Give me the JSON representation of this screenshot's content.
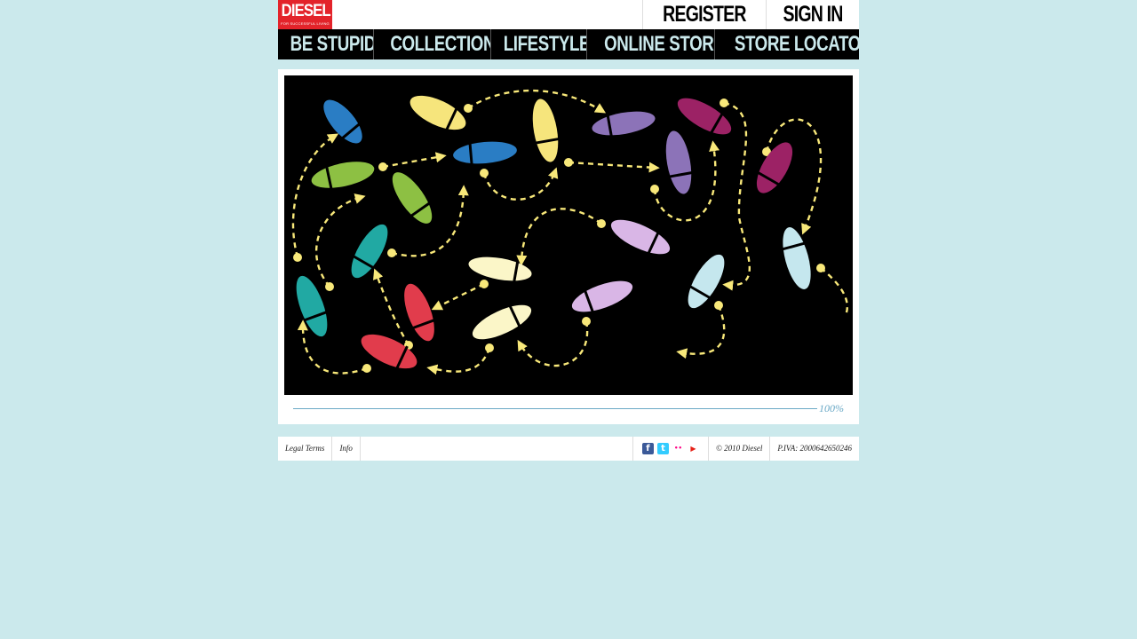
{
  "header": {
    "logo": {
      "word": "DIESEL",
      "tagline": "FOR SUCCESSFUL LIVING"
    },
    "register_label": "REGISTER",
    "signin_label": "SIGN IN"
  },
  "nav": {
    "items": [
      {
        "label": "BE STUPID"
      },
      {
        "label": "COLLECTIONS"
      },
      {
        "label": "LIFESTYLE"
      },
      {
        "label": "ONLINE STORE"
      },
      {
        "label": "STORE LOCATOR"
      }
    ]
  },
  "loader": {
    "progress_percent": 100,
    "progress_label": "100%"
  },
  "footer": {
    "legal_label": "Legal Terms",
    "info_label": "Info",
    "social": [
      {
        "icon": "facebook-icon",
        "glyph": "f",
        "color": "#3b5998"
      },
      {
        "icon": "twitter-icon",
        "glyph": "t",
        "color": "#33ccff"
      },
      {
        "icon": "flickr-icon",
        "glyph": "••",
        "color": "#ffffff"
      },
      {
        "icon": "youtube-icon",
        "glyph": "▶",
        "color": "#e62117"
      }
    ],
    "copyright": "© 2010 Diesel",
    "vat": "P.IVA: 2000642650246"
  },
  "colors": {
    "background": "#cbe9ec",
    "logo_red": "#e3232a",
    "nav_text": "#cbe9ec",
    "path_yellow": "#f8e87a"
  }
}
